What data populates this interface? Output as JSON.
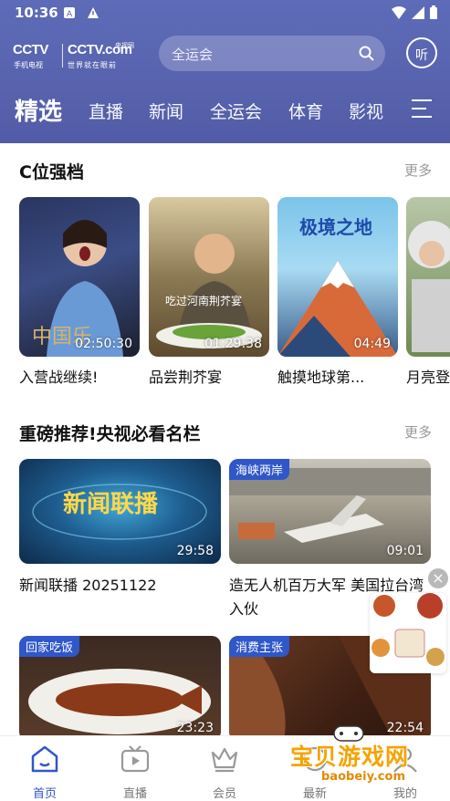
{
  "status": {
    "time": "10:36"
  },
  "brand": {
    "cctv_left": "CCTV",
    "cctv_left_sub": "手机电视",
    "cctv_right": "CCTV.com",
    "cctv_right_badge": "央视网",
    "cctv_right_sub": "世界就在眼前"
  },
  "search": {
    "placeholder": "全运会"
  },
  "listen": {
    "label": "听"
  },
  "nav": {
    "tabs": [
      "精选",
      "直播",
      "新闻",
      "全运会",
      "体育",
      "影视"
    ],
    "active": 0
  },
  "section1": {
    "title": "C位强档",
    "more": "更多",
    "items": [
      {
        "caption": "入营战继续!",
        "duration": "02:50:30",
        "overlay": "中国乐"
      },
      {
        "caption": "品尝荆芥宴",
        "duration": "01:29:38",
        "overlay": "吃过河南荆芥宴"
      },
      {
        "caption": "触摸地球第...",
        "duration": "04:49",
        "overlay": "极境之地"
      },
      {
        "caption": "月亮登",
        "duration": "",
        "overlay": ""
      }
    ]
  },
  "section2": {
    "title": "重磅推荐!央视必看名栏",
    "more": "更多",
    "items": [
      {
        "caption": "新闻联播 20251122",
        "duration": "29:58",
        "tag": "",
        "overlay": "新闻联播"
      },
      {
        "caption": "造无人机百万大军 美国拉台湾入伙",
        "duration": "09:01",
        "tag": "海峡两岸"
      },
      {
        "caption": "",
        "duration": "23:23",
        "tag": "回家吃饭"
      },
      {
        "caption": "",
        "duration": "22:54",
        "tag": "消费主张"
      }
    ]
  },
  "bottom_nav": [
    "首页",
    "直播",
    "会员",
    "最新",
    "我的"
  ],
  "watermark": {
    "text": "宝贝游戏网",
    "url": "baobeiy.com"
  },
  "colors": {
    "header": "#5863ae",
    "accent": "#2f57c9",
    "tag_bg": "#2f57c9"
  }
}
